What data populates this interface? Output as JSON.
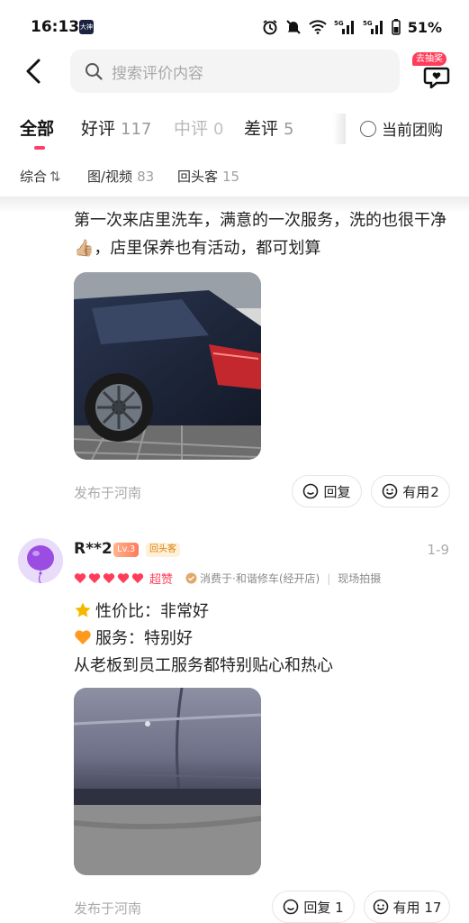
{
  "status_bar": {
    "time": "16:13",
    "app_badge": "大神",
    "battery": "51%"
  },
  "header": {
    "search_placeholder": "搜索评价内容",
    "gift_badge": "去抽奖"
  },
  "tabs": [
    {
      "label": "全部",
      "count": ""
    },
    {
      "label": "好评",
      "count": "117"
    },
    {
      "label": "中评",
      "count": "0"
    },
    {
      "label": "差评",
      "count": "5"
    }
  ],
  "current_group_label": "当前团购",
  "sub_filters": {
    "sort_label": "综合",
    "sort_icon": "⇅",
    "media_label": "图/视频",
    "media_count": "83",
    "return_label": "回头客",
    "return_count": "15"
  },
  "review1": {
    "text": "第一次来店里洗车，满意的一次服务，洗的也很干净👍🏼，店里保养也有活动，都可划算",
    "location": "发布于河南",
    "reply_label": "回复",
    "useful_label": "有用",
    "useful_count": "2"
  },
  "review2": {
    "username": "R**2",
    "level": "Lv.3",
    "returning_tag": "回头客",
    "date": "1-9",
    "rating_label": "超赞",
    "shop_info": "消费于·和谐修车(经开店)",
    "capture_label": "现场拍摄",
    "attr1_label": "性价比：非常好",
    "attr2_label": "服务：特别好",
    "text": "从老板到员工服务都特别贴心和热心",
    "location": "发布于河南",
    "reply_label": "回复",
    "reply_count": "1",
    "useful_label": "有用",
    "useful_count": "17"
  },
  "colors": {
    "accent": "#ff3d6a",
    "heart": "#ff3d5a",
    "level_tag": "#ff8a64",
    "returning_tag": "#d9820f"
  }
}
